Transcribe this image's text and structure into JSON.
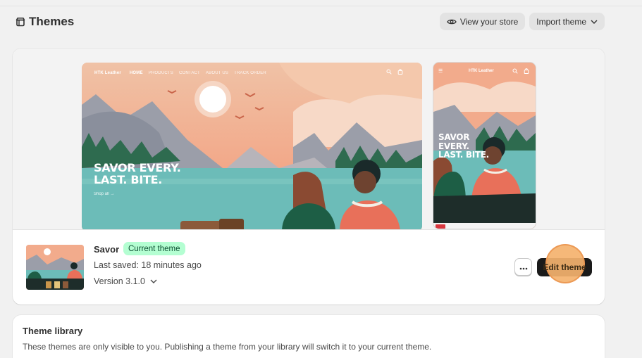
{
  "header": {
    "title": "Themes",
    "view_store_label": "View your store",
    "import_theme_label": "Import theme"
  },
  "current_theme": {
    "preview": {
      "desktop": {
        "brand": "HTK Leather",
        "nav": [
          "HOME",
          "PRODUCTS",
          "CONTACT",
          "ABOUT US",
          "TRACK ORDER"
        ],
        "hero_line1": "SAVOR EVERY.",
        "hero_line2": "LAST. BITE.",
        "shop_link": "Shop all →"
      },
      "mobile": {
        "brand": "HTK Leather",
        "hero_line1": "SAVOR",
        "hero_line2": "EVERY.",
        "hero_line3": "LAST. BITE."
      }
    },
    "name": "Savor",
    "badge": "Current theme",
    "last_saved": "Last saved: 18 minutes ago",
    "version": "Version 3.1.0",
    "edit_label": "Edit theme",
    "more_label": "•••"
  },
  "library": {
    "title": "Theme library",
    "description": "These themes are only visible to you. Publishing a theme from your library will switch it to your current theme."
  },
  "colors": {
    "badge_bg": "#b4fed2",
    "badge_text": "#0c5132",
    "primary_button": "#1a1a1a",
    "click_highlight": "#f4b26e"
  },
  "icons": {
    "title": "store-icon",
    "view_store": "eye-icon",
    "import": "chevron-down-icon",
    "version": "chevron-down-icon",
    "preview_nav": [
      "search-icon",
      "cart-icon"
    ],
    "mobile_menu": "menu-icon"
  }
}
